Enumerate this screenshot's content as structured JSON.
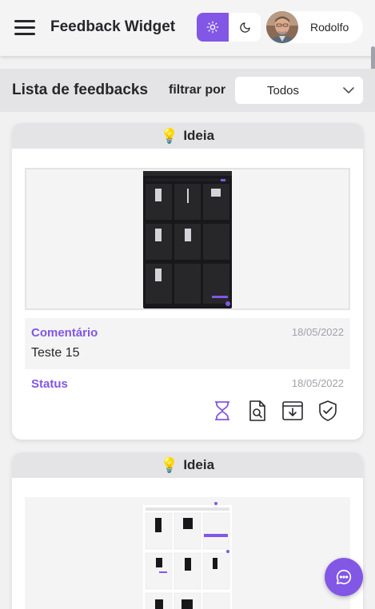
{
  "header": {
    "title": "Feedback Widget",
    "menu_icon": "hamburger-menu-icon",
    "theme": {
      "light_icon": "sun-icon",
      "dark_icon": "moon-icon",
      "active": "light"
    },
    "user": {
      "name": "Rodolfo",
      "avatar_icon": "user-avatar"
    }
  },
  "toolbar": {
    "title": "Lista de feedbacks",
    "filter_label": "filtrar por",
    "filter_value": "Todos"
  },
  "feedbacks": [
    {
      "emoji": "💡",
      "type": "Ideia",
      "comment_label": "Comentário",
      "comment_date": "18/05/2022",
      "comment": "Teste 15",
      "status_label": "Status",
      "status_date": "18/05/2022",
      "status_icons": [
        "hourglass-icon",
        "document-search-icon",
        "archive-download-icon",
        "shield-check-icon"
      ],
      "status_active": "hourglass-icon"
    },
    {
      "emoji": "💡",
      "type": "Ideia"
    }
  ],
  "fab": {
    "icon": "chat-bubble-icon"
  },
  "colors": {
    "accent": "#8257e5",
    "bg": "#f1f1f2",
    "card": "#ffffff",
    "muted": "#a1a1aa"
  }
}
